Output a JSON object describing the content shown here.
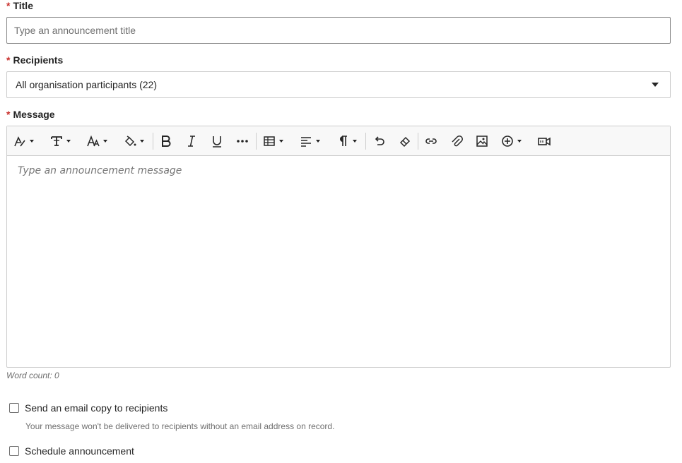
{
  "form": {
    "required_mark": "*",
    "title_label": "Title",
    "title_placeholder": "Type an announcement title",
    "title_value": "",
    "recipients_label": "Recipients",
    "recipients_value": "All organisation participants (22)",
    "message_label": "Message",
    "message_placeholder": "Type an announcement message",
    "word_count": "Word count: 0",
    "email_copy_label": "Send an email copy to recipients",
    "email_copy_checked": false,
    "email_copy_help": "Your message won't be delivered to recipients without an email address on record.",
    "schedule_label": "Schedule announcement",
    "schedule_checked": false
  },
  "toolbar": {
    "buttons": [
      {
        "icon": "text-style-icon",
        "dropdown": true
      },
      {
        "icon": "text-format-icon",
        "dropdown": true
      },
      {
        "icon": "font-size-icon",
        "dropdown": true
      },
      {
        "icon": "fill-color-icon",
        "dropdown": true
      },
      {
        "icon": "bold-icon",
        "dropdown": false
      },
      {
        "icon": "italic-icon",
        "dropdown": false
      },
      {
        "icon": "underline-icon",
        "dropdown": false
      },
      {
        "icon": "more-icon",
        "dropdown": false
      },
      {
        "icon": "table-icon",
        "dropdown": true
      },
      {
        "icon": "align-icon",
        "dropdown": true
      },
      {
        "icon": "paragraph-icon",
        "dropdown": true
      },
      {
        "icon": "undo-icon",
        "dropdown": false
      },
      {
        "icon": "eraser-icon",
        "dropdown": false
      },
      {
        "icon": "link-icon",
        "dropdown": false
      },
      {
        "icon": "attachment-icon",
        "dropdown": false
      },
      {
        "icon": "image-icon",
        "dropdown": false
      },
      {
        "icon": "insert-content-icon",
        "dropdown": true
      },
      {
        "icon": "video-icon",
        "dropdown": false
      }
    ]
  },
  "colors": {
    "required": "#c9302c",
    "text": "#262626",
    "muted": "#6f6f6f",
    "border": "#cdcdcd",
    "toolbar_bg": "#f8f8f8"
  }
}
